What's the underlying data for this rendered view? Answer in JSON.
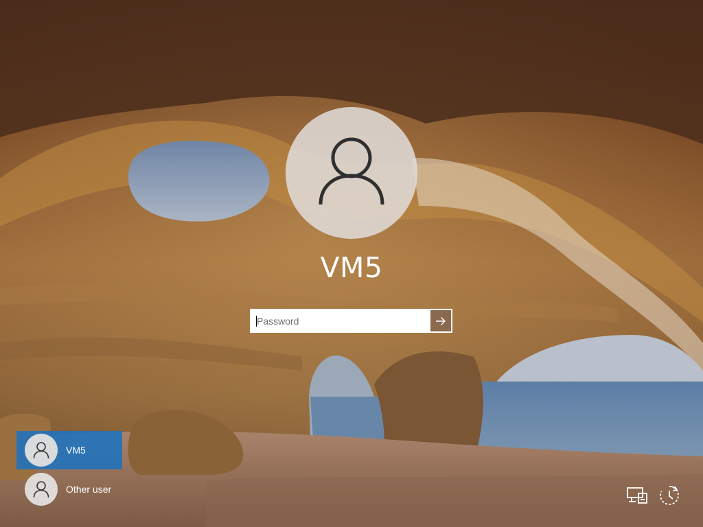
{
  "account": {
    "username": "VM5"
  },
  "password_field": {
    "placeholder": "Password",
    "value": ""
  },
  "user_list": [
    {
      "label": "VM5",
      "selected": true
    },
    {
      "label": "Other user",
      "selected": false
    }
  ],
  "corner_icons": {
    "network": "network-icon",
    "ease_of_access": "ease-of-access-icon"
  },
  "colors": {
    "selected_tile": "#1e72be",
    "submit_button": "#8a6a4e"
  }
}
